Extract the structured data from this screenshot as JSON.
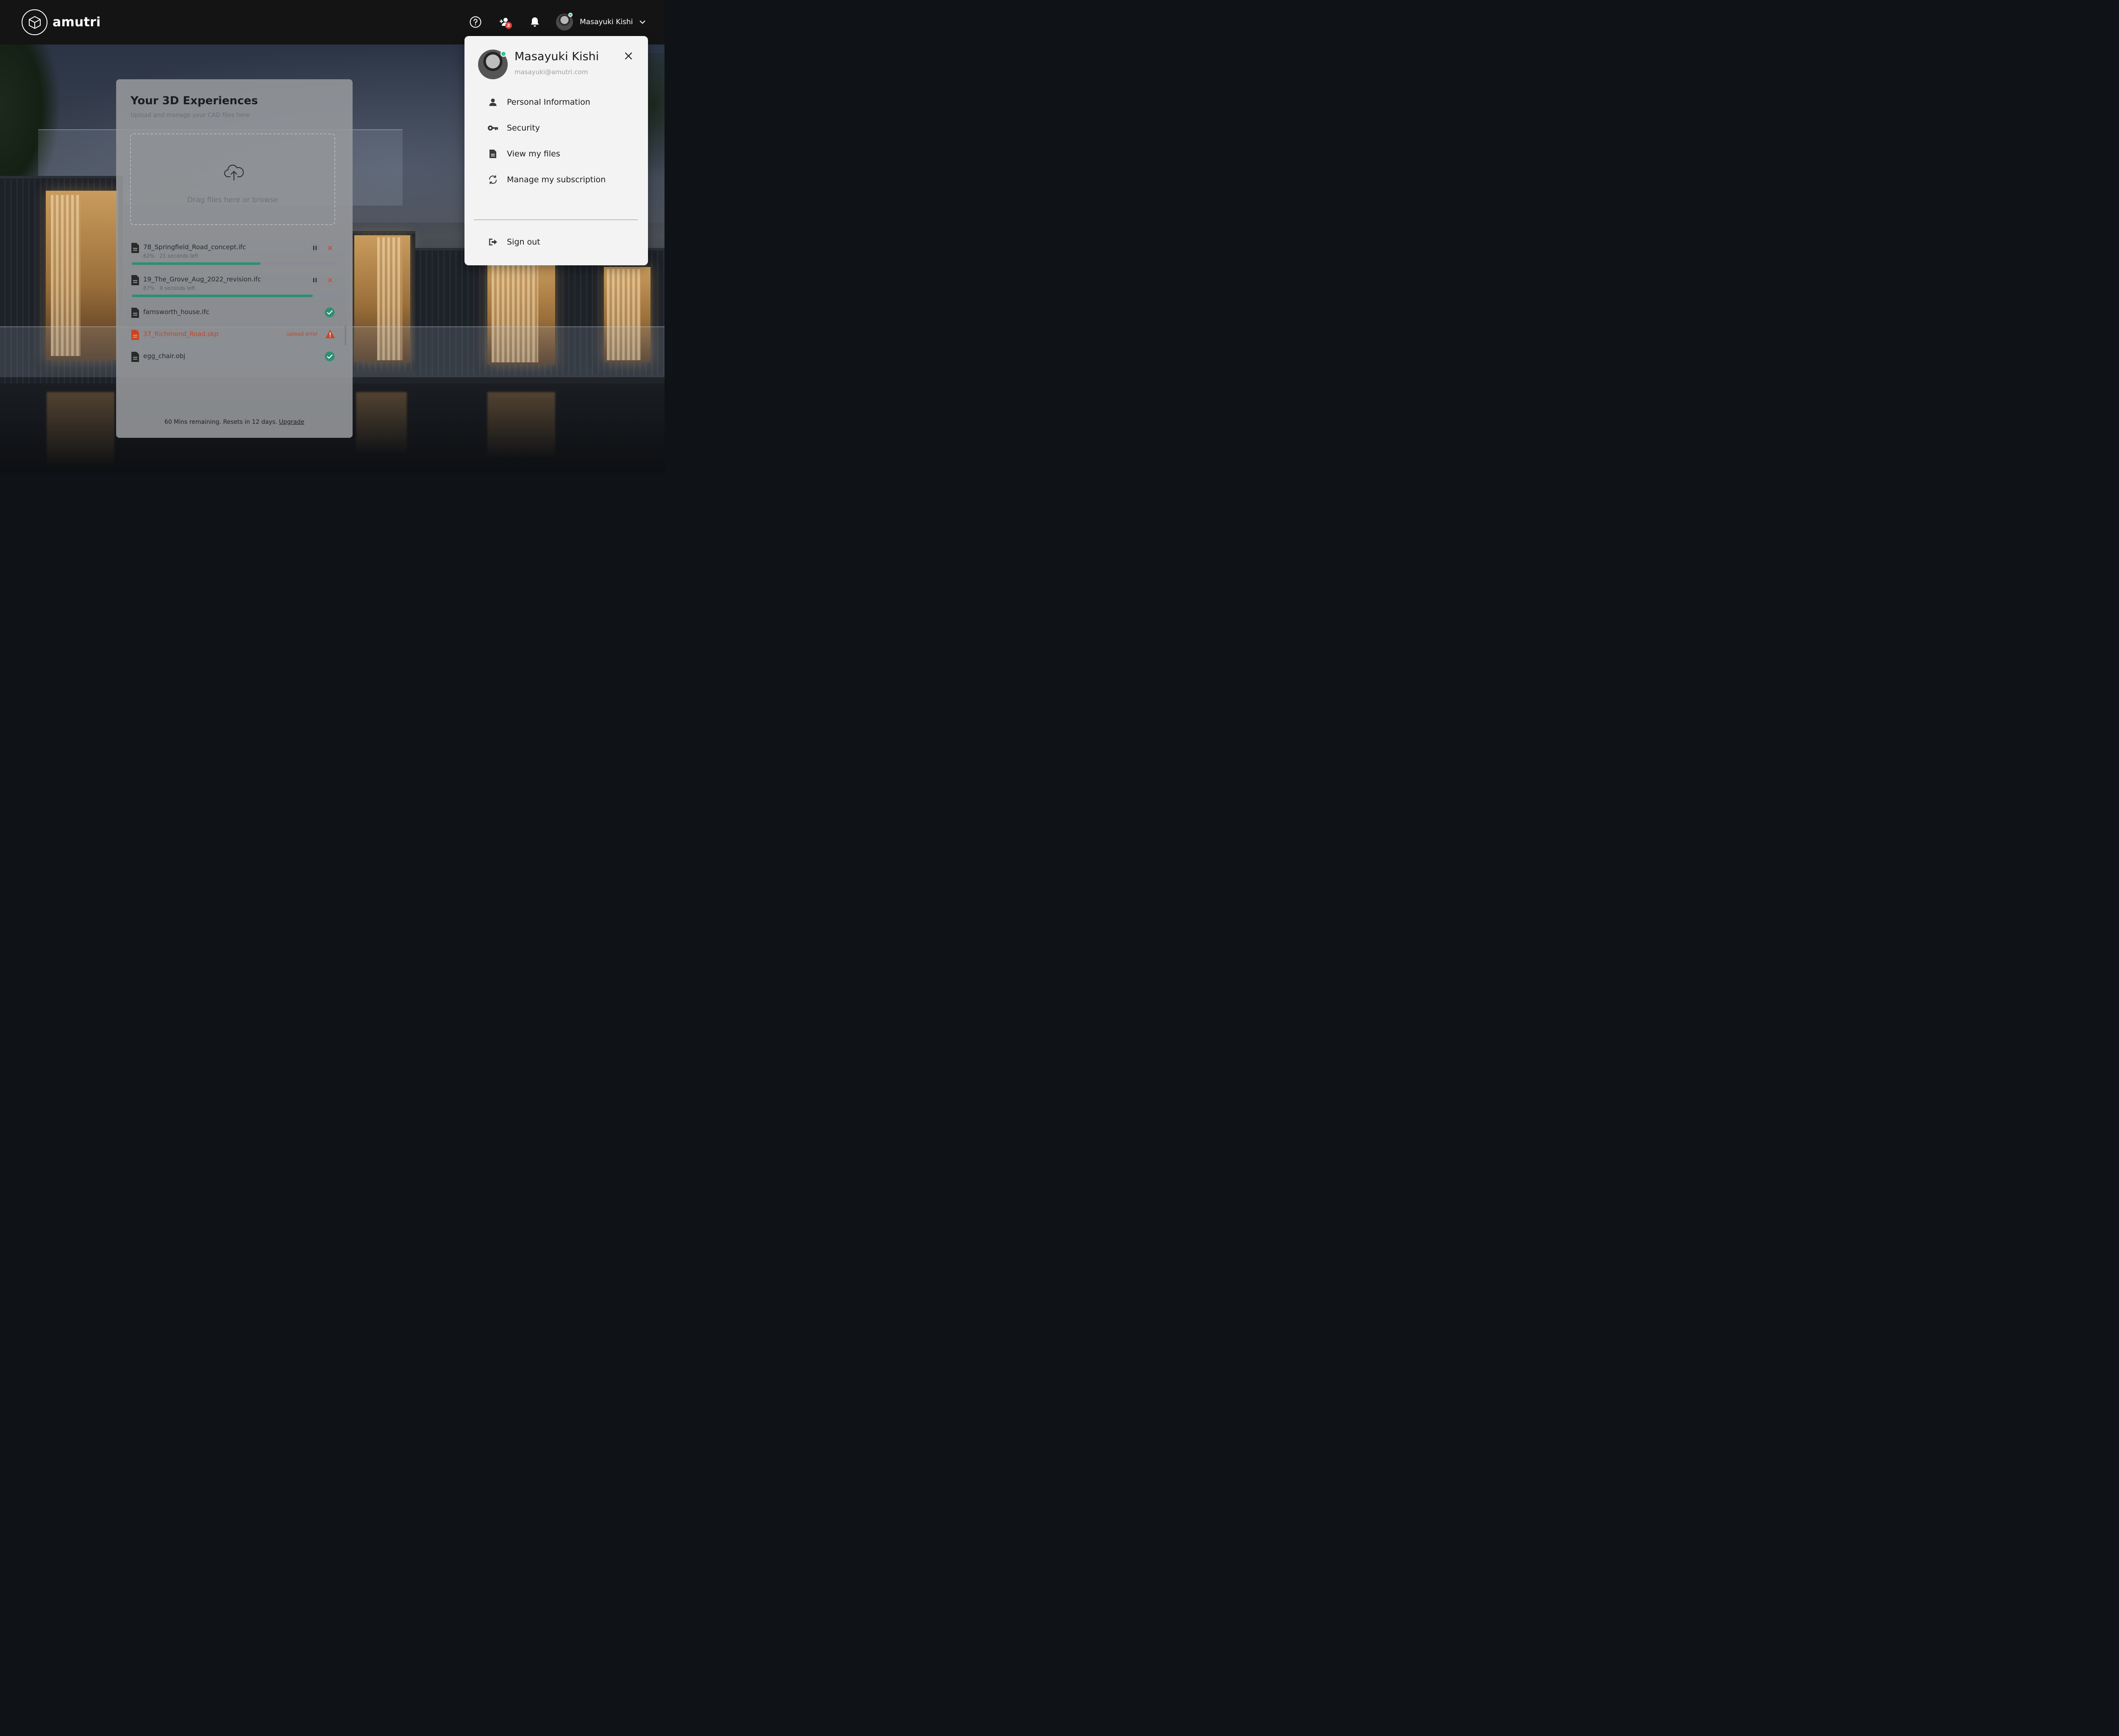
{
  "app": {
    "brand": "amutri"
  },
  "topbar": {
    "icons": [
      "help-icon",
      "add-user-icon",
      "bell-icon"
    ],
    "invite_badge_count": "2",
    "user_name": "Masayuki Kishi"
  },
  "upload_card": {
    "title": "Your 3D Experiences",
    "subtitle": "Upload and manage your CAD files here",
    "dropzone_text": "Drag files here or browse",
    "files": [
      {
        "name": "78_Springfield_Road_concept.ifc",
        "percent_label": "62%",
        "time_left": "21 seconds left",
        "progress": 0.62,
        "status": "uploading"
      },
      {
        "name": "19_The_Grove_Aug_2022_revision.ifc",
        "percent_label": "87%",
        "time_left": "9 seconds left",
        "progress": 0.87,
        "status": "uploading"
      },
      {
        "name": "farnsworth_house.ifc",
        "status": "complete"
      },
      {
        "name": "37_Richmond_Road.skp",
        "status": "error",
        "error_text": "upload error"
      },
      {
        "name": "egg_chair.obj",
        "status": "complete"
      }
    ],
    "footer_text": "60 Mins remaining. Resets in 12 days.",
    "upgrade_link": "Upgrade"
  },
  "profile_menu": {
    "name": "Masayuki Kishi",
    "email": "masayuki@amutri.com",
    "items": [
      {
        "label": "Personal Information",
        "icon": "person-icon"
      },
      {
        "label": "Security",
        "icon": "key-icon"
      },
      {
        "label": "View my files",
        "icon": "file-icon"
      },
      {
        "label": "Manage my subscription",
        "icon": "refresh-icon"
      }
    ],
    "sign_out_label": "Sign out",
    "sign_out_icon": "sign-out-icon"
  },
  "colors": {
    "accent_green": "#2e8f72",
    "online_dot": "#3bbfa0",
    "error": "#c9441f",
    "badge": "#e2423a",
    "topbar": "#141414"
  }
}
